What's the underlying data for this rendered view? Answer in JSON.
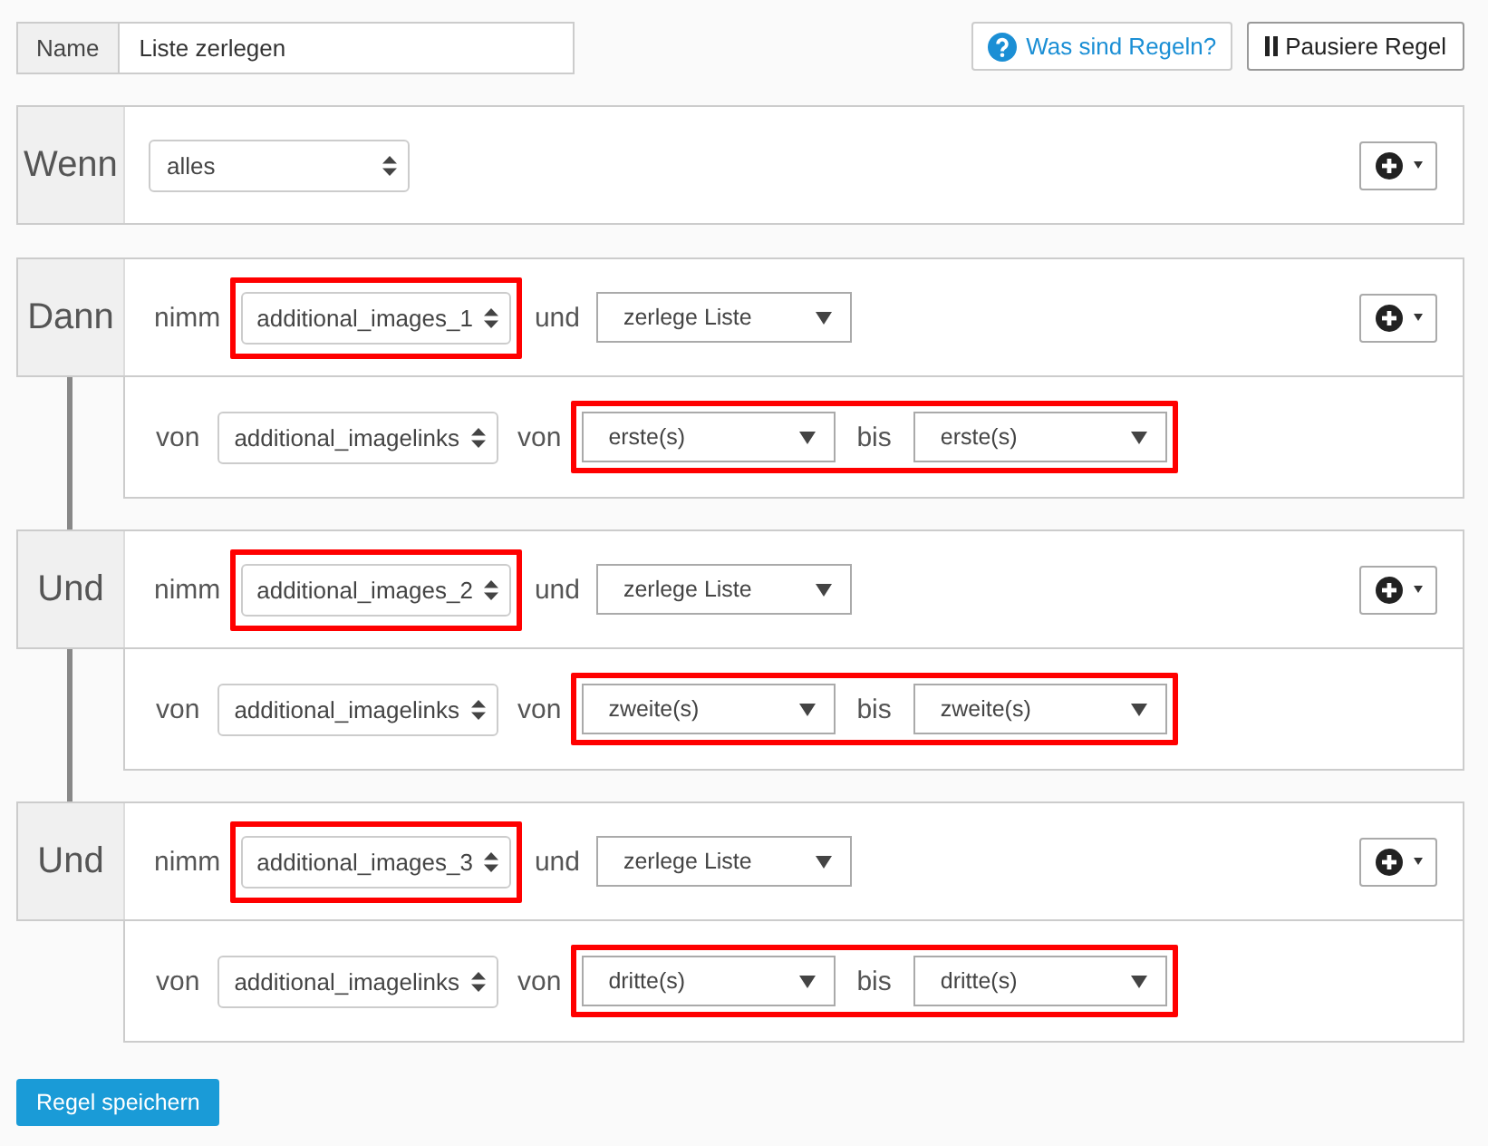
{
  "name_field": {
    "label": "Name",
    "value": "Liste zerlegen"
  },
  "help_button": {
    "label": "Was sind Regeln?"
  },
  "pause_button": {
    "label": "Pausiere Regel"
  },
  "condition": {
    "label": "Wenn",
    "scope": "alles"
  },
  "actions": [
    {
      "label": "Dann",
      "take_label": "nimm",
      "source": {
        "value": "additional_images_1",
        "highlighted": true
      },
      "and_label": "und",
      "operation": "zerlege Liste",
      "from_label": "von",
      "list": "additional_imagelinks",
      "range_label": "von",
      "range": {
        "highlighted": true,
        "start": "erste(s)",
        "end_label": "bis",
        "end": "erste(s)"
      }
    },
    {
      "label": "Und",
      "take_label": "nimm",
      "source": {
        "value": "additional_images_2",
        "highlighted": true
      },
      "and_label": "und",
      "operation": "zerlege Liste",
      "from_label": "von",
      "list": "additional_imagelinks",
      "range_label": "von",
      "range": {
        "highlighted": true,
        "start": "zweite(s)",
        "end_label": "bis",
        "end": "zweite(s)"
      }
    },
    {
      "label": "Und",
      "take_label": "nimm",
      "source": {
        "value": "additional_images_3",
        "highlighted": true
      },
      "and_label": "und",
      "operation": "zerlege Liste",
      "from_label": "von",
      "list": "additional_imagelinks",
      "range_label": "von",
      "range": {
        "highlighted": true,
        "start": "dritte(s)",
        "end_label": "bis",
        "end": "dritte(s)"
      }
    }
  ],
  "save_button": {
    "label": "Regel speichern"
  }
}
